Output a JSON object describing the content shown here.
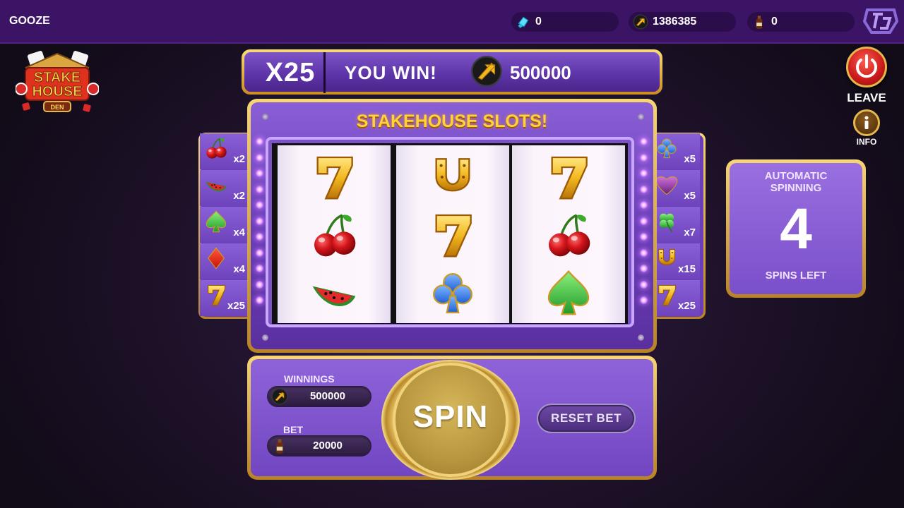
{
  "header": {
    "username": "GOOZE",
    "gems": "0",
    "coins": "1386385",
    "bottles": "0"
  },
  "banner": {
    "multiplier": "X25",
    "message": "YOU WIN!",
    "amount": "500000"
  },
  "machine": {
    "title": "STAKEHOUSE SLOTS!",
    "reels": [
      [
        "seven-icon",
        "cherry-icon",
        "watermelon-icon"
      ],
      [
        "horseshoe-icon",
        "seven-icon",
        "club-icon"
      ],
      [
        "seven-icon",
        "cherry-icon",
        "spade-icon"
      ]
    ]
  },
  "paytable_left": [
    {
      "icon": "cherry-icon",
      "mult": "x2"
    },
    {
      "icon": "watermelon-icon",
      "mult": "x2"
    },
    {
      "icon": "spade-icon",
      "mult": "x4"
    },
    {
      "icon": "diamond-icon",
      "mult": "x4"
    },
    {
      "icon": "seven-icon",
      "mult": "x25"
    }
  ],
  "paytable_right": [
    {
      "icon": "club-icon",
      "mult": "x5"
    },
    {
      "icon": "heart-icon",
      "mult": "x5"
    },
    {
      "icon": "clover-icon",
      "mult": "x7"
    },
    {
      "icon": "horseshoe-icon",
      "mult": "x15"
    },
    {
      "icon": "seven-icon",
      "mult": "x25"
    }
  ],
  "auto": {
    "title_line1": "AUTOMATIC",
    "title_line2": "SPINNING",
    "count": "4",
    "caption": "SPINS LEFT"
  },
  "controls": {
    "leave_label": "LEAVE",
    "info_label": "INFO",
    "winnings_label": "WINNINGS",
    "winnings_value": "500000",
    "bet_label": "BET",
    "bet_value": "20000",
    "spin_label": "SPIN",
    "reset_label": "RESET BET"
  },
  "logo": {
    "line1": "STAKE",
    "line2": "HOUSE",
    "line3": "DEN"
  },
  "colors": {
    "accent_gold": "#f6d675",
    "purple": "#6a3eb8",
    "title_yellow": "#ffd23a",
    "leave_red": "#c8191a"
  }
}
